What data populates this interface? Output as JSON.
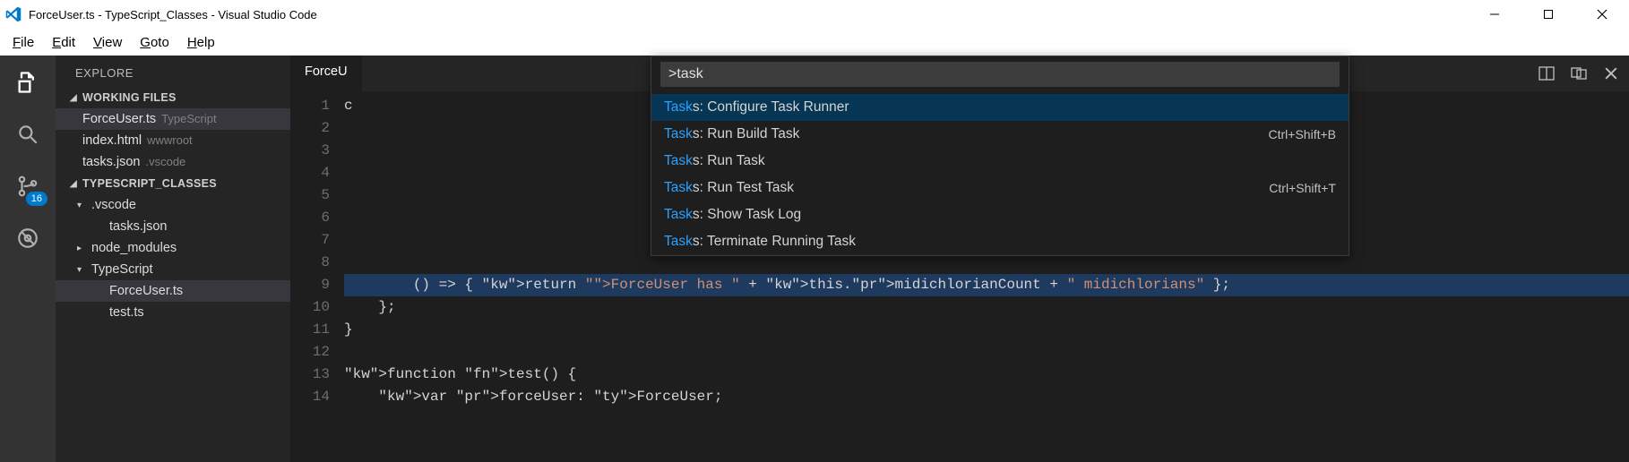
{
  "window": {
    "title": "ForceUser.ts - TypeScript_Classes - Visual Studio Code"
  },
  "menu": {
    "file": "File",
    "edit": "Edit",
    "view": "View",
    "goto": "Goto",
    "help": "Help"
  },
  "activity": {
    "git_badge": "16"
  },
  "sidebar": {
    "title": "EXPLORE",
    "working_files_header": "WORKING FILES",
    "working_files": [
      {
        "name": "ForceUser.ts",
        "desc": "TypeScript",
        "selected": true
      },
      {
        "name": "index.html",
        "desc": "wwwroot",
        "selected": false
      },
      {
        "name": "tasks.json",
        "desc": ".vscode",
        "selected": false
      }
    ],
    "project_header": "TYPESCRIPT_CLASSES",
    "tree": [
      {
        "label": ".vscode",
        "depth": 1,
        "arrow": "▾",
        "selected": false
      },
      {
        "label": "tasks.json",
        "depth": 2,
        "arrow": "",
        "selected": false
      },
      {
        "label": "node_modules",
        "depth": 1,
        "arrow": "▸",
        "selected": false
      },
      {
        "label": "TypeScript",
        "depth": 1,
        "arrow": "▾",
        "selected": false
      },
      {
        "label": "ForceUser.ts",
        "depth": 2,
        "arrow": "",
        "selected": true
      },
      {
        "label": "test.ts",
        "depth": 2,
        "arrow": "",
        "selected": false
      }
    ]
  },
  "editor": {
    "tab": "ForceUser.ts",
    "tab_visible": "ForceU",
    "line_start": 1,
    "lines": [
      "c",
      "",
      "",
      "",
      "",
      "",
      "",
      "",
      "        () => { return \"ForceUser has \" + this.midichlorianCount + \" midichlorians\" };",
      "    };",
      "}",
      "",
      "function test() {",
      "    var forceUser: ForceUser;"
    ],
    "highlight_line": 9
  },
  "palette": {
    "input": ">task",
    "results": [
      {
        "match": "Task",
        "rest": "s: Configure Task Runner",
        "kb": "",
        "selected": true
      },
      {
        "match": "Task",
        "rest": "s: Run Build Task",
        "kb": "Ctrl+Shift+B",
        "selected": false
      },
      {
        "match": "Task",
        "rest": "s: Run Task",
        "kb": "",
        "selected": false
      },
      {
        "match": "Task",
        "rest": "s: Run Test Task",
        "kb": "Ctrl+Shift+T",
        "selected": false
      },
      {
        "match": "Task",
        "rest": "s: Show Task Log",
        "kb": "",
        "selected": false
      },
      {
        "match": "Task",
        "rest": "s: Terminate Running Task",
        "kb": "",
        "selected": false
      }
    ]
  }
}
